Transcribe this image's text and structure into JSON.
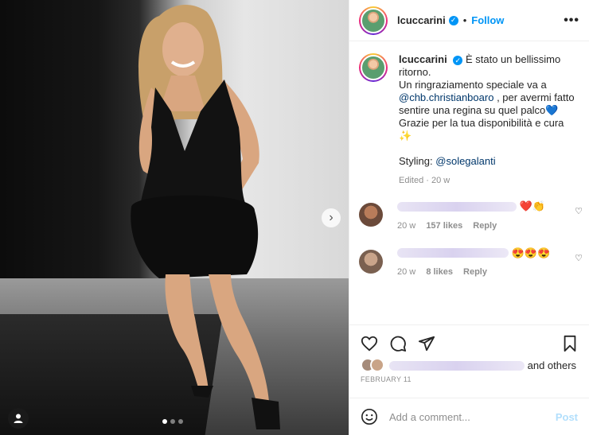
{
  "post": {
    "username": "lcuccarini",
    "follow_label": "Follow",
    "more_label": "•••",
    "next_arrow": "›"
  },
  "caption": {
    "username": "lcuccarini",
    "line1": "È stato un bellissimo ritorno.",
    "line2_prefix": "Un ringraziamento speciale va a",
    "mention1": "@chb.christianboaro",
    "line2_suffix": ", per avermi fatto sentire una regina su quel palco",
    "heart_emoji": "💙",
    "line3": "Grazie per la tua disponibilità e cura",
    "sparkle_emoji": "✨",
    "styling_prefix": "Styling:",
    "mention2": "@solegalanti",
    "meta": "Edited · 20 w"
  },
  "comments": [
    {
      "emojis": "❤️👏",
      "age": "20 w",
      "likes": "157 likes",
      "reply": "Reply"
    },
    {
      "emojis": "😍😍😍",
      "age": "20 w",
      "likes": "8 likes",
      "reply": "Reply"
    }
  ],
  "likes": {
    "suffix": "and others",
    "date": "FEBRUARY 11"
  },
  "add_comment": {
    "placeholder": "Add a comment...",
    "post_label": "Post"
  },
  "colors": {
    "accent": "#0095f6",
    "link": "#00376b",
    "muted": "#8e8e8e"
  }
}
